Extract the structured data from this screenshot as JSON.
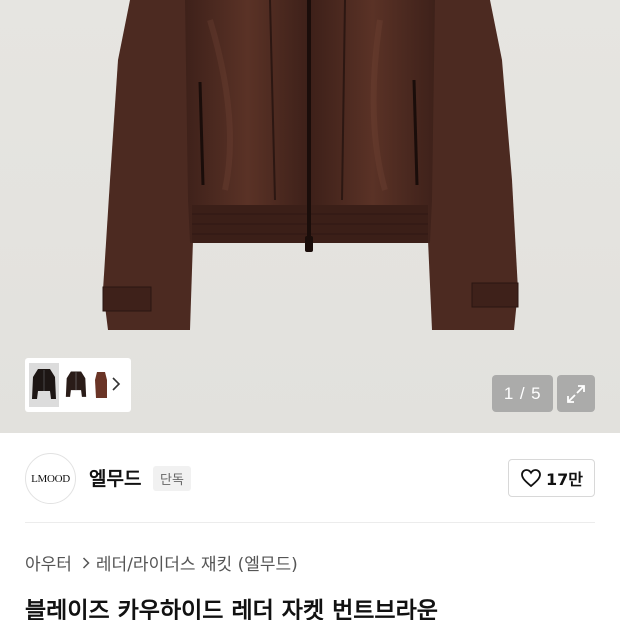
{
  "gallery": {
    "current": "1",
    "separator": "/",
    "total": "5",
    "thumbnails": [
      {
        "name": "jacket-front-thumbnail",
        "active": true
      },
      {
        "name": "jacket-alt-thumbnail",
        "active": false
      },
      {
        "name": "jacket-side-thumbnail",
        "active": false
      }
    ],
    "jacket_color": "#4a2820"
  },
  "brand": {
    "logo_text": "LMOOD",
    "name": "엘무드",
    "badge": "단독",
    "likes": "17만"
  },
  "breadcrumb": {
    "category": "아우터",
    "subcategory": "레더/라이더스 재킷 (엘무드)"
  },
  "product": {
    "title": "블레이즈 카우하이드 레더 자켓 번트브라운"
  }
}
